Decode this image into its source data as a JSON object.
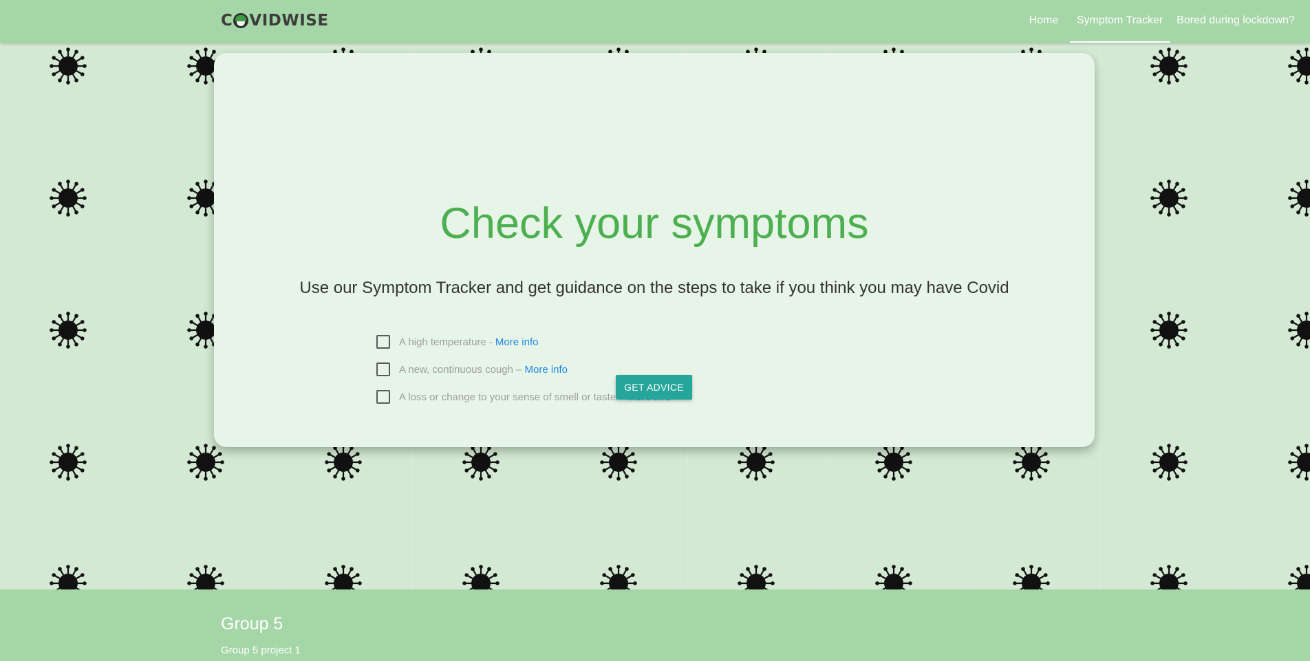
{
  "brand": {
    "logo_text_left": "C",
    "logo_text_right": "VIDWISE"
  },
  "nav": {
    "items": [
      {
        "label": "Home",
        "active": false
      },
      {
        "label": "Symptom Tracker",
        "active": true
      },
      {
        "label": "Bored during lockdown?",
        "active": false
      }
    ]
  },
  "main": {
    "title": "Check your symptoms",
    "subtitle": "Use our Symptom Tracker and get guidance on the steps to take if you think you may have Covid",
    "symptoms": [
      {
        "label": "A high temperature -",
        "link": "More info",
        "checked": false
      },
      {
        "label": "A new, continuous cough –",
        "link": "More info",
        "checked": false
      },
      {
        "label": "A loss or change to your sense of smell or taste –",
        "link": "More info",
        "checked": false
      }
    ],
    "button_label": "GET ADVICE"
  },
  "footer": {
    "title": "Group 5",
    "text": "Group 5 project 1"
  },
  "colors": {
    "navbar": "#a5d6a7",
    "background": "#d3e9d3",
    "card": "#e7f4e8",
    "title": "#4caf50",
    "button": "#26a69a",
    "link": "#1e88e5"
  },
  "icons": {
    "background_pattern": "virus-icon"
  }
}
